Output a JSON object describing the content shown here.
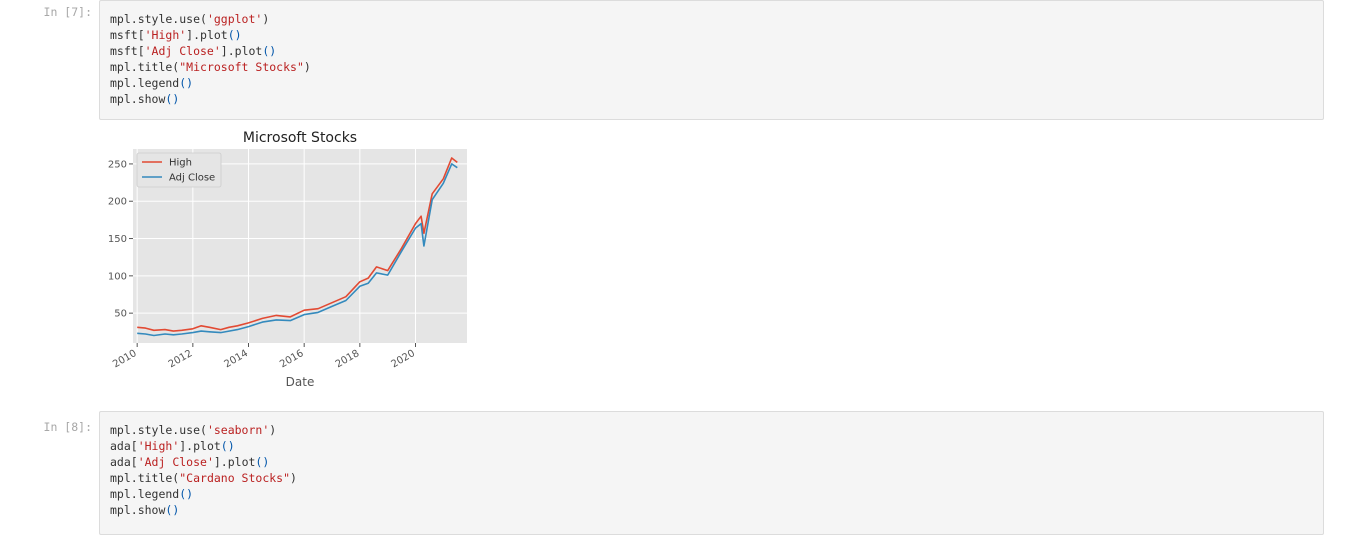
{
  "cells": [
    {
      "prompt": "In [7]:",
      "lines": [
        [
          {
            "t": "mpl.style.use("
          },
          {
            "t": "'ggplot'",
            "c": "str"
          },
          {
            "t": ")"
          }
        ],
        [
          {
            "t": "msft["
          },
          {
            "t": "'High'",
            "c": "str"
          },
          {
            "t": "].plot"
          },
          {
            "t": "()",
            "c": "bracket"
          }
        ],
        [
          {
            "t": "msft["
          },
          {
            "t": "'Adj Close'",
            "c": "str"
          },
          {
            "t": "].plot"
          },
          {
            "t": "()",
            "c": "bracket"
          }
        ],
        [
          {
            "t": "mpl.title("
          },
          {
            "t": "\"Microsoft Stocks\"",
            "c": "str"
          },
          {
            "t": ")"
          }
        ],
        [
          {
            "t": "mpl.legend"
          },
          {
            "t": "()",
            "c": "bracket"
          }
        ],
        [
          {
            "t": "mpl.show"
          },
          {
            "t": "()",
            "c": "bracket"
          }
        ]
      ]
    },
    {
      "prompt": "In [8]:",
      "lines": [
        [
          {
            "t": "mpl.style.use("
          },
          {
            "t": "'seaborn'",
            "c": "str"
          },
          {
            "t": ")"
          }
        ],
        [
          {
            "t": "ada["
          },
          {
            "t": "'High'",
            "c": "str"
          },
          {
            "t": "].plot"
          },
          {
            "t": "()",
            "c": "bracket"
          }
        ],
        [
          {
            "t": "ada["
          },
          {
            "t": "'Adj Close'",
            "c": "str"
          },
          {
            "t": "].plot"
          },
          {
            "t": "()",
            "c": "bracket"
          }
        ],
        [
          {
            "t": "mpl.title("
          },
          {
            "t": "\"Cardano Stocks\"",
            "c": "str"
          },
          {
            "t": ")"
          }
        ],
        [
          {
            "t": "mpl.legend"
          },
          {
            "t": "()",
            "c": "bracket"
          }
        ],
        [
          {
            "t": "mpl.show"
          },
          {
            "t": "()",
            "c": "bracket"
          }
        ]
      ]
    }
  ],
  "chart_data": {
    "type": "line",
    "title": "Microsoft Stocks",
    "xlabel": "Date",
    "ylabel": "",
    "xlim": [
      2009.85,
      2021.85
    ],
    "ylim": [
      10,
      270
    ],
    "x_ticks": [
      2010,
      2012,
      2014,
      2016,
      2018,
      2020
    ],
    "x_tick_labels": [
      "2010",
      "2012",
      "2014",
      "2016",
      "2018",
      "2020"
    ],
    "y_ticks": [
      50,
      100,
      150,
      200,
      250
    ],
    "grid": true,
    "legend_position": "top-left",
    "style": "ggplot",
    "colors": {
      "background": "#e5e5e5",
      "grid": "#ffffff",
      "text": "#555555"
    },
    "x": [
      2010.0,
      2010.3,
      2010.6,
      2011.0,
      2011.3,
      2011.6,
      2012.0,
      2012.3,
      2012.6,
      2013.0,
      2013.3,
      2013.6,
      2014.0,
      2014.5,
      2015.0,
      2015.5,
      2016.0,
      2016.5,
      2017.0,
      2017.5,
      2018.0,
      2018.3,
      2018.6,
      2019.0,
      2019.5,
      2020.0,
      2020.2,
      2020.3,
      2020.6,
      2021.0,
      2021.3,
      2021.5
    ],
    "series": [
      {
        "name": "High",
        "color": "#e24a33",
        "values": [
          31,
          30,
          27,
          28,
          26,
          27,
          29,
          33,
          31,
          28,
          31,
          33,
          37,
          43,
          47,
          45,
          54,
          56,
          64,
          72,
          92,
          97,
          112,
          107,
          137,
          170,
          180,
          157,
          210,
          230,
          258,
          252
        ]
      },
      {
        "name": "Adj Close",
        "color": "#348abd",
        "values": [
          23,
          22,
          20,
          22,
          21,
          22,
          24,
          26,
          25,
          24,
          26,
          28,
          32,
          38,
          41,
          40,
          48,
          51,
          59,
          67,
          86,
          90,
          104,
          101,
          133,
          164,
          170,
          140,
          202,
          224,
          250,
          245
        ]
      }
    ]
  }
}
